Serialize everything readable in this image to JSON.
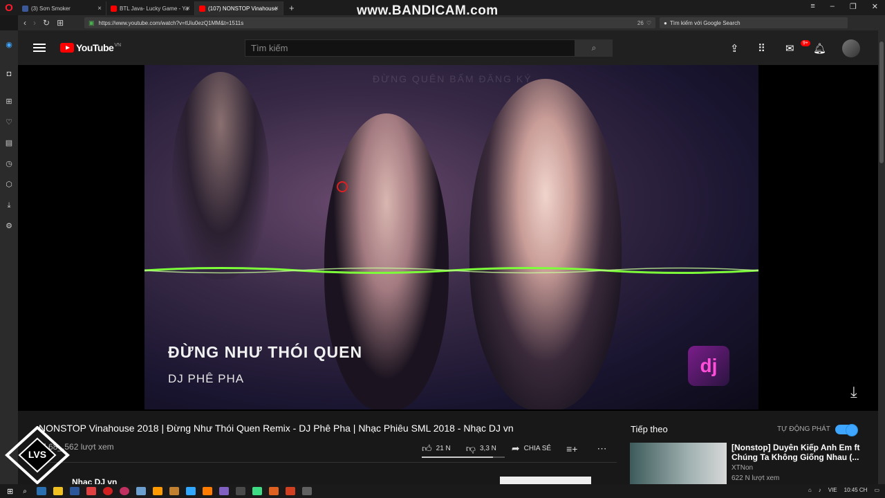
{
  "browser": {
    "tabs": [
      {
        "label": "(3) Sơn Smoker",
        "favicon_color": "#3b5998"
      },
      {
        "label": "BTL Java- Lucky Game - Ya",
        "favicon_color": "#ff0000"
      },
      {
        "label": "(107) NONSTOP Vinahouse",
        "favicon_color": "#ff0000"
      }
    ],
    "url": "https://www.youtube.com/watch?v=tUiu0ezQ1MM&t=1511s",
    "tab_count": "26",
    "search_placeholder": "Tìm kiếm với Google Search",
    "recorder_watermark": "www.BANDICAM.com"
  },
  "youtube": {
    "logo_text": "YouTube",
    "region": "VN",
    "search_placeholder": "Tìm kiếm",
    "notification_count": "9+"
  },
  "video": {
    "overlay_title": "ĐỪNG NHƯ THÓI QUEN",
    "overlay_artist": "DJ PHÊ PHA",
    "channel_logo": "dj",
    "title": "NONSTOP Vinahouse 2018 | Đừng Như Thói Quen Remix - DJ Phê Pha | Nhạc Phiêu SML 2018 - Nhạc DJ vn",
    "views": "7.68_.562 lượt xem",
    "likes": "21 N",
    "dislikes": "3,3 N",
    "share_label": "CHIA SẺ",
    "like_ratio": 0.86,
    "channel_name": "Nhạc DJ vn"
  },
  "upnext": {
    "heading": "Tiếp theo",
    "autoplay_label": "TỰ ĐỘNG PHÁT",
    "autoplay_on": true,
    "items": [
      {
        "title": "[Nonstop] Duyên Kiếp Anh Em ft Chúng Ta Không Giống Nhau (...",
        "channel": "XTNon",
        "views": "622 N lượt xem"
      }
    ]
  },
  "overlay_logo_text": "LVS",
  "taskbar": {
    "language": "VIE",
    "time": "10:45 CH"
  }
}
